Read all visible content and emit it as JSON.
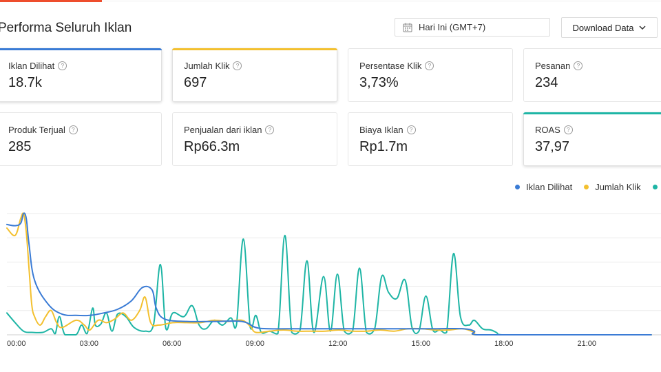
{
  "header": {
    "title": "Performa Seluruh Iklan",
    "date_filter": "Hari Ini (GMT+7)",
    "download_label": "Download Data"
  },
  "metrics": [
    {
      "label": "Iklan Dilihat",
      "value": "18.7k",
      "accent": "#3a7bd5",
      "active": true
    },
    {
      "label": "Jumlah Klik",
      "value": "697",
      "accent": "#f3c02f",
      "active": true
    },
    {
      "label": "Persentase Klik",
      "value": "3,73%",
      "accent": "",
      "active": false
    },
    {
      "label": "Pesanan",
      "value": "234",
      "accent": "",
      "active": false
    },
    {
      "label": "Produk Terjual",
      "value": "285",
      "accent": "",
      "active": false
    },
    {
      "label": "Penjualan dari iklan",
      "value": "Rp66.3m",
      "accent": "",
      "active": false
    },
    {
      "label": "Biaya Iklan",
      "value": "Rp1.7m",
      "accent": "",
      "active": false
    },
    {
      "label": "ROAS",
      "value": "37,97",
      "accent": "#1eb5a5",
      "active": true
    }
  ],
  "legend": [
    {
      "label": "Iklan Dilihat",
      "color": "#3a7bd5"
    },
    {
      "label": "Jumlah Klik",
      "color": "#f3c02f"
    },
    {
      "label": "",
      "color": "#1eb5a5"
    }
  ],
  "chart_data": {
    "type": "line",
    "x_ticks": [
      "00:00",
      "03:00",
      "06:00",
      "09:00",
      "12:00",
      "15:00",
      "18:00",
      "21:00"
    ],
    "grid": true,
    "y_max": 100,
    "series": [
      {
        "name": "Iklan Dilihat",
        "color": "#3a7bd5",
        "points": [
          [
            0.0,
            91
          ],
          [
            0.3,
            90
          ],
          [
            0.5,
            92
          ],
          [
            0.6,
            100
          ],
          [
            0.7,
            96
          ],
          [
            0.8,
            75
          ],
          [
            1.0,
            45
          ],
          [
            1.5,
            25
          ],
          [
            2.0,
            17
          ],
          [
            2.5,
            16
          ],
          [
            3.0,
            16
          ],
          [
            3.5,
            18
          ],
          [
            4.0,
            21
          ],
          [
            4.5,
            28
          ],
          [
            4.9,
            39
          ],
          [
            5.25,
            37
          ],
          [
            5.4,
            22
          ],
          [
            5.7,
            13
          ],
          [
            6.5,
            11
          ],
          [
            7.5,
            11
          ],
          [
            8.5,
            11
          ],
          [
            9.0,
            6
          ],
          [
            9.5,
            5
          ],
          [
            10.5,
            5
          ],
          [
            11.5,
            5
          ],
          [
            12.5,
            5
          ],
          [
            13.5,
            5
          ],
          [
            14.5,
            5
          ],
          [
            15.5,
            5
          ],
          [
            16.5,
            5
          ],
          [
            16.9,
            3
          ],
          [
            17.0,
            0
          ],
          [
            19.0,
            0
          ],
          [
            23.3,
            0
          ]
        ]
      },
      {
        "name": "Jumlah Klik",
        "color": "#f3c02f",
        "points": [
          [
            0.0,
            88
          ],
          [
            0.3,
            82
          ],
          [
            0.5,
            96
          ],
          [
            0.6,
            100
          ],
          [
            0.7,
            85
          ],
          [
            0.8,
            55
          ],
          [
            0.9,
            25
          ],
          [
            1.0,
            15
          ],
          [
            1.2,
            8
          ],
          [
            1.4,
            15
          ],
          [
            1.6,
            20
          ],
          [
            1.8,
            10
          ],
          [
            2.0,
            6
          ],
          [
            2.5,
            12
          ],
          [
            2.8,
            8
          ],
          [
            3.0,
            4
          ],
          [
            3.3,
            12
          ],
          [
            3.6,
            10
          ],
          [
            3.9,
            13
          ],
          [
            4.2,
            18
          ],
          [
            4.5,
            12
          ],
          [
            4.8,
            20
          ],
          [
            5.0,
            31
          ],
          [
            5.2,
            10
          ],
          [
            5.5,
            8
          ],
          [
            6.0,
            10
          ],
          [
            6.5,
            10
          ],
          [
            7.0,
            10
          ],
          [
            7.5,
            12
          ],
          [
            8.0,
            11
          ],
          [
            8.5,
            12
          ],
          [
            8.8,
            7
          ],
          [
            9.0,
            2
          ],
          [
            9.5,
            3
          ],
          [
            10.0,
            4
          ],
          [
            10.5,
            3
          ],
          [
            11.0,
            3
          ],
          [
            11.5,
            3
          ],
          [
            12.0,
            4
          ],
          [
            12.5,
            3
          ],
          [
            13.0,
            3
          ],
          [
            13.5,
            4
          ],
          [
            14.0,
            3
          ],
          [
            14.5,
            5
          ],
          [
            15.0,
            5
          ],
          [
            15.5,
            4
          ],
          [
            16.0,
            4
          ],
          [
            16.5,
            5
          ],
          [
            16.9,
            2
          ],
          [
            17.0,
            0
          ],
          [
            19.0,
            0
          ],
          [
            23.3,
            0
          ]
        ]
      },
      {
        "name": "",
        "color": "#1eb5a5",
        "points": [
          [
            0.0,
            18
          ],
          [
            0.3,
            10
          ],
          [
            0.6,
            3
          ],
          [
            0.9,
            2
          ],
          [
            1.3,
            2
          ],
          [
            1.6,
            5
          ],
          [
            1.75,
            1
          ],
          [
            1.9,
            15
          ],
          [
            2.1,
            0
          ],
          [
            2.5,
            0
          ],
          [
            2.7,
            8
          ],
          [
            2.9,
            1
          ],
          [
            3.1,
            22
          ],
          [
            3.2,
            8
          ],
          [
            3.4,
            9
          ],
          [
            3.6,
            18
          ],
          [
            3.8,
            3
          ],
          [
            4.0,
            17
          ],
          [
            4.3,
            15
          ],
          [
            4.6,
            6
          ],
          [
            5.0,
            3
          ],
          [
            5.3,
            8
          ],
          [
            5.55,
            58
          ],
          [
            5.75,
            5
          ],
          [
            6.0,
            18
          ],
          [
            6.4,
            15
          ],
          [
            6.7,
            24
          ],
          [
            6.95,
            8
          ],
          [
            7.2,
            5
          ],
          [
            7.5,
            12
          ],
          [
            7.8,
            8
          ],
          [
            8.1,
            14
          ],
          [
            8.3,
            8
          ],
          [
            8.55,
            79
          ],
          [
            8.8,
            6
          ],
          [
            9.0,
            16
          ],
          [
            9.2,
            2
          ],
          [
            9.5,
            3
          ],
          [
            9.8,
            1
          ],
          [
            10.05,
            82
          ],
          [
            10.3,
            2
          ],
          [
            10.6,
            4
          ],
          [
            10.85,
            61
          ],
          [
            11.1,
            2
          ],
          [
            11.45,
            48
          ],
          [
            11.7,
            3
          ],
          [
            11.95,
            50
          ],
          [
            12.2,
            3
          ],
          [
            12.5,
            3
          ],
          [
            12.75,
            55
          ],
          [
            13.0,
            2
          ],
          [
            13.3,
            5
          ],
          [
            13.55,
            48
          ],
          [
            13.8,
            35
          ],
          [
            14.1,
            30
          ],
          [
            14.4,
            45
          ],
          [
            14.65,
            6
          ],
          [
            14.9,
            3
          ],
          [
            15.15,
            32
          ],
          [
            15.4,
            4
          ],
          [
            15.65,
            4
          ],
          [
            15.9,
            2
          ],
          [
            16.15,
            67
          ],
          [
            16.4,
            15
          ],
          [
            16.7,
            8
          ],
          [
            16.9,
            12
          ],
          [
            17.2,
            5
          ],
          [
            17.5,
            4
          ],
          [
            17.7,
            2
          ],
          [
            17.9,
            0
          ],
          [
            19.0,
            0
          ],
          [
            23.3,
            0
          ]
        ]
      }
    ]
  }
}
